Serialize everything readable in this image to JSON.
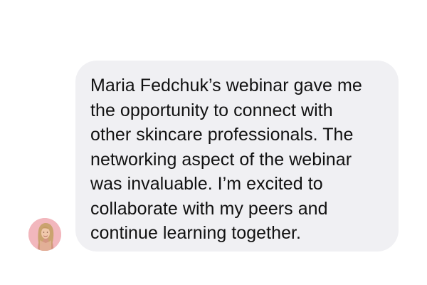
{
  "message": {
    "text": "Maria Fedchuk’s webinar gave me\nthe opportunity to connect with\nother skincare professionals. The\nnetworking aspect of the webinar\nwas invaluable. I’m excited to\ncollaborate with my peers and\ncontinue learning together."
  },
  "colors": {
    "background": "#ffffff",
    "bubble": "#f0f0f3",
    "text": "#111111",
    "avatar_bg": "#f2b7bd"
  },
  "icons": {
    "avatar": "sender-avatar-photo"
  }
}
